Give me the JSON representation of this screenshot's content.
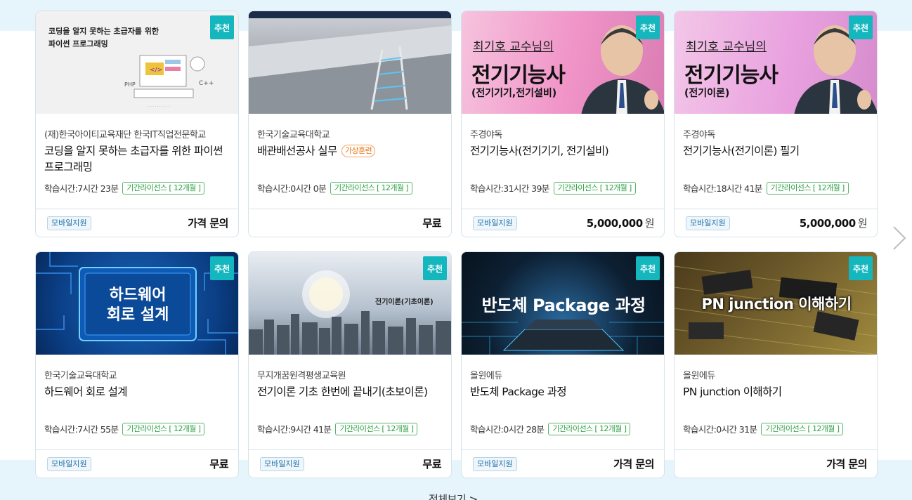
{
  "recommend_label": "추천",
  "mobile_label": "모바일지원",
  "license_label": "기간라이선스 [ 12개월 ]",
  "study_time_prefix": "학습시간: ",
  "currency": "원",
  "more_label": "전체보기 >",
  "cards": [
    {
      "thumb_lines": [
        "코딩을 알지 못하는 초급자를 위한",
        "파이썬 프로그래밍"
      ],
      "provider": "(재)한국아이티교육재단 한국IT직업전문학교",
      "title": "코딩을 알지 못하는 초급자를 위한 파이썬 프로그래밍",
      "tag": "",
      "time": "7시간 23분",
      "mobile": true,
      "price": "가격 문의",
      "price_unit": ""
    },
    {
      "thumb_lines": [],
      "provider": "한국기술교육대학교",
      "title": "배관배선공사 실무",
      "tag": "가상훈련",
      "time": "0시간 0분",
      "mobile": false,
      "price": "무료",
      "price_unit": ""
    },
    {
      "thumb_lines": [
        "최기호 교수님의",
        "전기기능사",
        "(전기기기,전기설비)"
      ],
      "provider": "주경야독",
      "title": "전기기능사(전기기기, 전기설비)",
      "tag": "",
      "time": "31시간 39분",
      "mobile": true,
      "price": "5,000,000",
      "price_unit": "원"
    },
    {
      "thumb_lines": [
        "최기호 교수님의",
        "전기기능사",
        "(전기이론)"
      ],
      "provider": "주경야독",
      "title": "전기기능사(전기이론) 필기",
      "tag": "",
      "time": "18시간 41분",
      "mobile": true,
      "price": "5,000,000",
      "price_unit": "원"
    },
    {
      "thumb_lines": [
        "하드웨어",
        "회로 설계"
      ],
      "provider": "한국기술교육대학교",
      "title": "하드웨어 회로 설계",
      "tag": "",
      "time": "7시간 55분",
      "mobile": true,
      "price": "무료",
      "price_unit": ""
    },
    {
      "thumb_lines": [
        "전기이론(기초이론)"
      ],
      "provider": "무지개꿈원격평생교육원",
      "title": "전기이론 기초 한번에 끝내기(초보이론)",
      "tag": "",
      "time": "9시간 41분",
      "mobile": true,
      "price": "무료",
      "price_unit": ""
    },
    {
      "thumb_lines": [
        "반도체 Package 과정"
      ],
      "provider": "올윈에듀",
      "title": "반도체 Package 과정",
      "tag": "",
      "time": "0시간 28분",
      "mobile": true,
      "price": "가격 문의",
      "price_unit": ""
    },
    {
      "thumb_lines": [
        "PN junction 이해하기"
      ],
      "provider": "올윈에듀",
      "title": "PN junction 이해하기",
      "tag": "",
      "time": "0시간 31분",
      "mobile": false,
      "price": "가격 문의",
      "price_unit": ""
    }
  ]
}
